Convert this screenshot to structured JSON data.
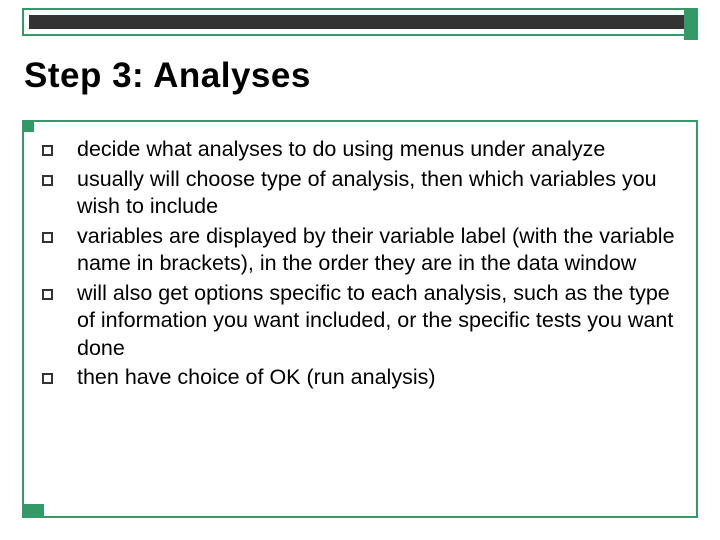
{
  "title": "Step 3:  Analyses",
  "bullets": [
    "decide what analyses to do using menus under analyze",
    "usually will choose type of analysis, then which variables you wish to include",
    "variables are displayed by their variable label (with the variable name in brackets), in the order they are in the data window",
    "will also get options specific to each analysis, such as the type of information you want included, or the specific tests you want done",
    "then have choice of OK (run analysis)"
  ]
}
